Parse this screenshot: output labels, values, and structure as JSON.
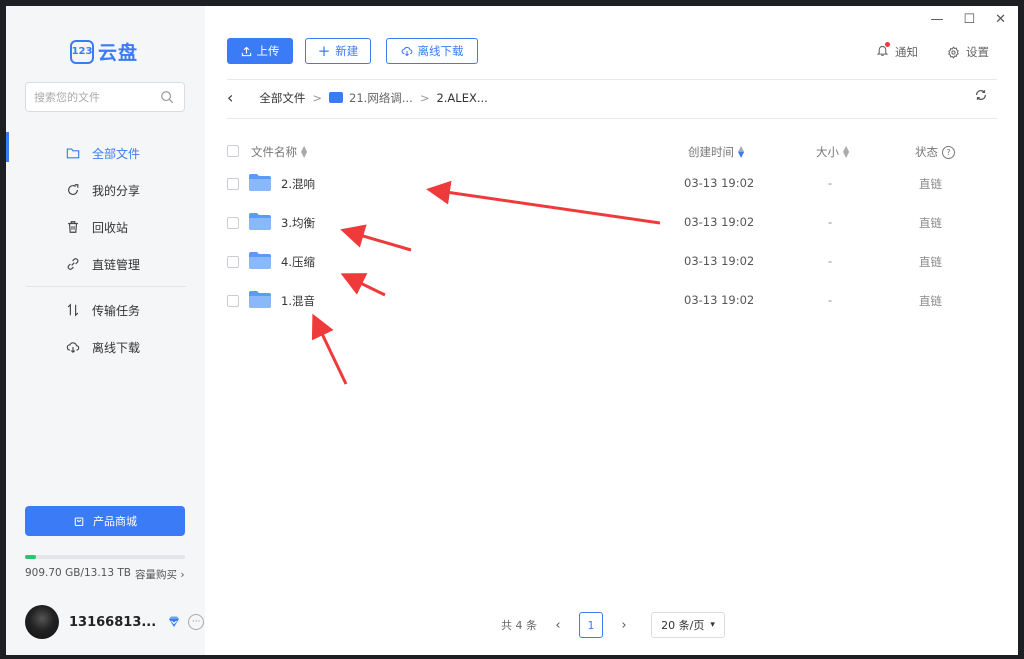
{
  "app": {
    "logo_mark": "123",
    "logo_text": "云盘"
  },
  "search": {
    "placeholder": "搜索您的文件"
  },
  "sidebar": {
    "items": [
      {
        "label": "全部文件",
        "icon": "folder-icon",
        "active": true
      },
      {
        "label": "我的分享",
        "icon": "share-icon"
      },
      {
        "label": "回收站",
        "icon": "trash-icon"
      },
      {
        "label": "直链管理",
        "icon": "link-icon"
      },
      {
        "label": "传输任务",
        "icon": "transfer-icon"
      },
      {
        "label": "离线下载",
        "icon": "cloud-download-icon"
      }
    ],
    "shop_label": "产品商城",
    "storage": {
      "text": "909.70 GB/13.13 TB",
      "used_fraction": 0.068,
      "buy_label": "容量购买 ›",
      "bar_color": "#28c76f"
    },
    "user": {
      "name": "13166813..."
    }
  },
  "toolbar": {
    "upload": "上传",
    "new": "新建",
    "offline": "离线下载",
    "notify": "通知",
    "settings": "设置"
  },
  "breadcrumb": {
    "back": "‹",
    "root": "全部文件",
    "mid": "21.网络调...",
    "current": "2.ALEX..."
  },
  "table": {
    "headers": {
      "name": "文件名称",
      "created": "创建时间",
      "size": "大小",
      "status": "状态"
    },
    "rows": [
      {
        "name": "2.混响",
        "created": "03-13 19:02",
        "size": "-",
        "status": "直链"
      },
      {
        "name": "3.均衡",
        "created": "03-13 19:02",
        "size": "-",
        "status": "直链"
      },
      {
        "name": "4.压缩",
        "created": "03-13 19:02",
        "size": "-",
        "status": "直链"
      },
      {
        "name": "1.混音",
        "created": "03-13 19:02",
        "size": "-",
        "status": "直链"
      }
    ]
  },
  "pagination": {
    "total": "共 4 条",
    "current": "1",
    "page_size": "20 条/页"
  },
  "colors": {
    "accent": "#3b7bf5",
    "annotation": "#ee3a3a"
  }
}
